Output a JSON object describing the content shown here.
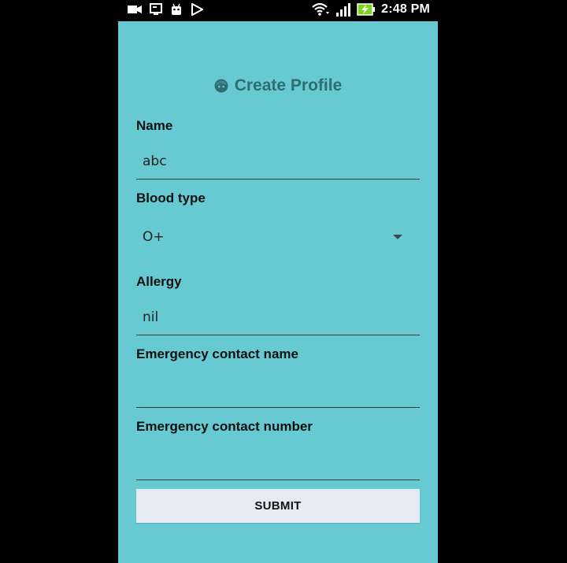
{
  "status_bar": {
    "time": "2:48 PM",
    "left_icons": [
      "video-camera-icon",
      "screencast-icon",
      "android-icon",
      "play-store-icon"
    ],
    "right_icons": [
      "wifi-icon",
      "cellular-signal-icon",
      "battery-charging-icon"
    ]
  },
  "form": {
    "title": "Create Profile",
    "title_icon": "face-icon",
    "fields": {
      "name": {
        "label": "Name",
        "value": "abc"
      },
      "blood_type": {
        "label": "Blood type",
        "value": "O+"
      },
      "allergy": {
        "label": "Allergy",
        "value": "nil"
      },
      "emergency_name": {
        "label": "Emergency contact name",
        "value": ""
      },
      "emergency_number": {
        "label": "Emergency contact number",
        "value": ""
      }
    },
    "submit_label": "SUBMIT"
  },
  "colors": {
    "background": "#67c9d1",
    "title": "#2e6e72",
    "button": "#e5eaf3",
    "battery": "#7ed321"
  }
}
